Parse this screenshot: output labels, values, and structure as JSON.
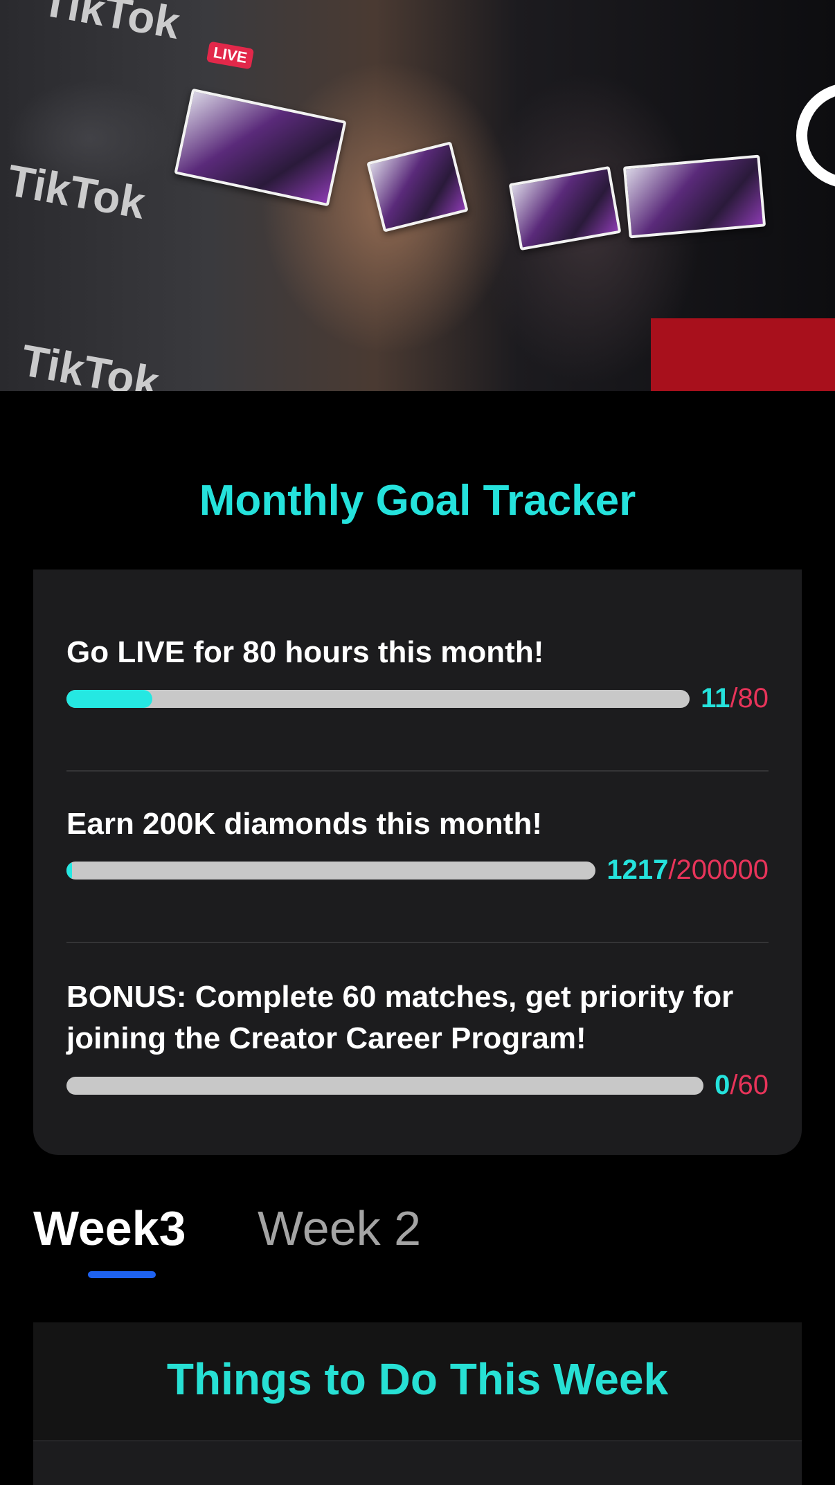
{
  "hero": {
    "backdrop_brand": "TikTok",
    "backdrop_badge": "LIVE"
  },
  "tracker": {
    "title": "Monthly Goal Tracker",
    "goals": [
      {
        "text": "Go LIVE for 80 hours this month!",
        "current": "11",
        "target": "/80",
        "progress": 0.1375
      },
      {
        "text": "Earn 200K diamonds this month!",
        "current": "1217",
        "target": "/200000",
        "progress": 0.006
      },
      {
        "text": "BONUS: Complete 60 matches, get priority for joining the Creator Career Program!",
        "current": "0",
        "target": "/60",
        "progress": 0
      }
    ]
  },
  "tabs": [
    {
      "label": "Week3",
      "active": true
    },
    {
      "label": "Week 2",
      "active": false
    }
  ],
  "things": {
    "title": "Things to Do This Week"
  },
  "colors": {
    "accent_cyan": "#25e2dc",
    "target_pink": "#e8345a",
    "tab_underline": "#1e62f0"
  }
}
